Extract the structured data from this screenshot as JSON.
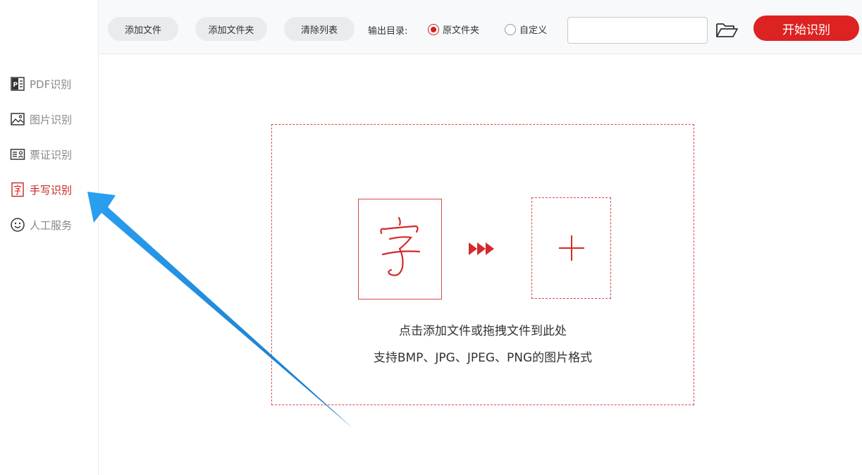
{
  "sidebar": {
    "items": [
      {
        "label": "PDF识别",
        "icon": "pdf-icon",
        "active": false
      },
      {
        "label": "图片识别",
        "icon": "image-icon",
        "active": false
      },
      {
        "label": "票证识别",
        "icon": "id-card-icon",
        "active": false
      },
      {
        "label": "手写识别",
        "icon": "handwriting-icon",
        "active": true
      },
      {
        "label": "人工服务",
        "icon": "smiley-icon",
        "active": false
      }
    ]
  },
  "toolbar": {
    "add_file": "添加文件",
    "add_folder": "添加文件夹",
    "clear_list": "清除列表",
    "output_label": "输出目录:",
    "output_options": [
      {
        "label": "原文件夹",
        "checked": true
      },
      {
        "label": "自定义",
        "checked": false
      }
    ],
    "path_value": "",
    "start": "开始识别"
  },
  "main": {
    "sample_char": "字",
    "hint_line1": "点击添加文件或拖拽文件到此处",
    "hint_line2": "支持BMP、JPG、JPEG、PNG的图片格式"
  },
  "colors": {
    "accent": "#dd2222",
    "dashed_border": "#d84a4a",
    "annotation_arrow": "#1e8fe0"
  }
}
